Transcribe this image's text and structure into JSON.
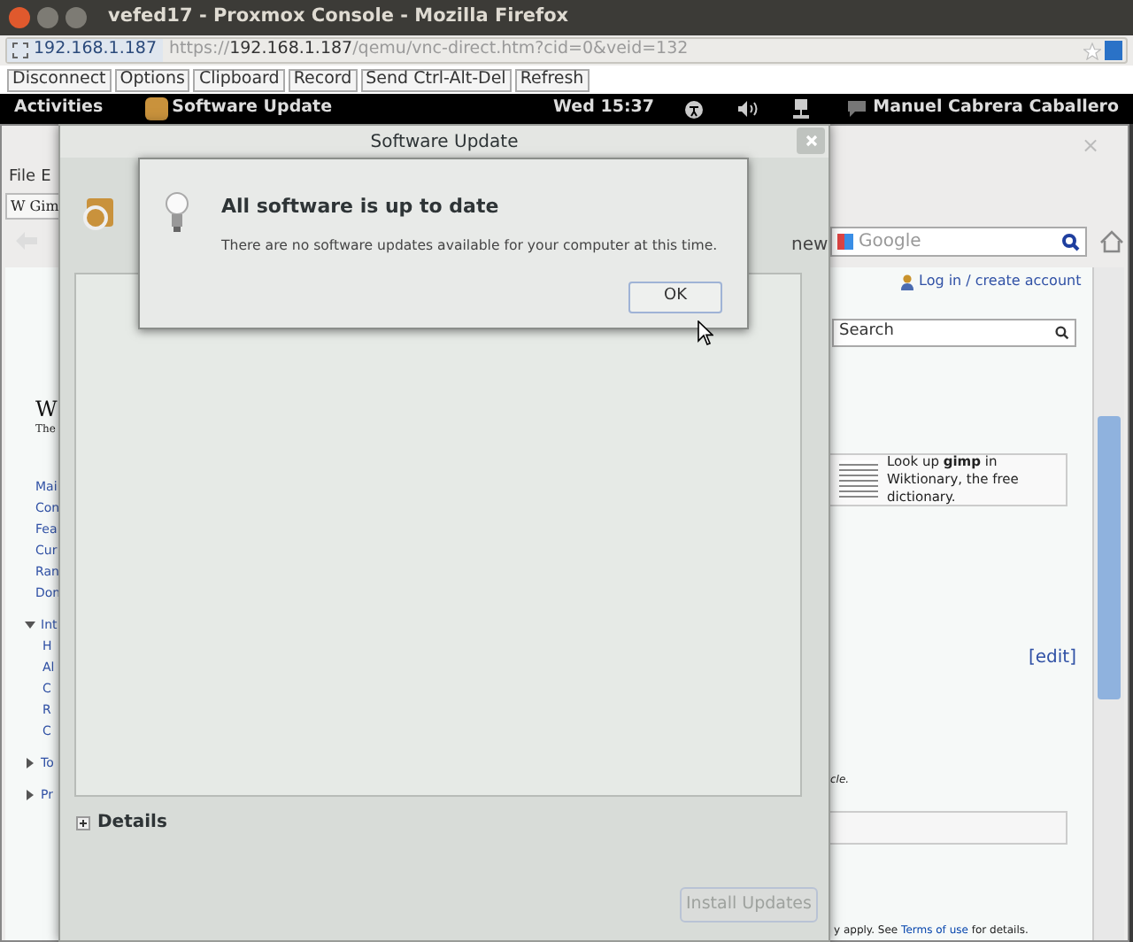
{
  "browser": {
    "title": "vefed17 - Proxmox Console - Mozilla Firefox",
    "site": "192.168.1.187",
    "url_scheme": "https://",
    "url_host": "192.168.1.187",
    "url_path": "/qemu/vnc-direct.htm?cid=0&veid=132"
  },
  "vnc_toolbar": [
    "Disconnect",
    "Options",
    "Clipboard",
    "Record",
    "Send Ctrl-Alt-Del",
    "Refresh"
  ],
  "top_bar": {
    "activities": "Activities",
    "app": "Software Update",
    "clock": "Wed 15:37",
    "user": "Manuel Cabrera Caballero"
  },
  "background_window": {
    "close": "×",
    "menu": [
      "File",
      "E"
    ],
    "tab": "W Gim",
    "search_placeholder": "Google",
    "login": "Log in / create account",
    "wiki_search_placeholder": "Search",
    "logo": "W",
    "logo_sub": "The",
    "sidebar_links": [
      "Mai",
      "Con",
      "Fea",
      "Cur",
      "Ran",
      "Don"
    ],
    "sections": [
      {
        "label": "Int",
        "expanded": true,
        "links": [
          "H",
          "Al",
          "C",
          "R",
          "C"
        ]
      },
      {
        "label": "To",
        "expanded": false
      },
      {
        "label": "Pr",
        "expanded": false
      }
    ],
    "wiktionary": "Look up **gimp** in Wiktionary, the free dictionary.",
    "edit_link": "[edit]",
    "fragment": "cle.",
    "footer_before": "y apply. See",
    "footer_link": "Terms of use",
    "footer_after": "for details."
  },
  "software_update": {
    "title": "Software Update",
    "fragment": "new",
    "details": {
      "label": "Details",
      "expanded": false
    },
    "install_button": {
      "label": "Install Updates",
      "disabled": true
    }
  },
  "alert": {
    "title": "All software is up to date",
    "message": "There are no software updates available for your computer at this time.",
    "ok": "OK"
  }
}
